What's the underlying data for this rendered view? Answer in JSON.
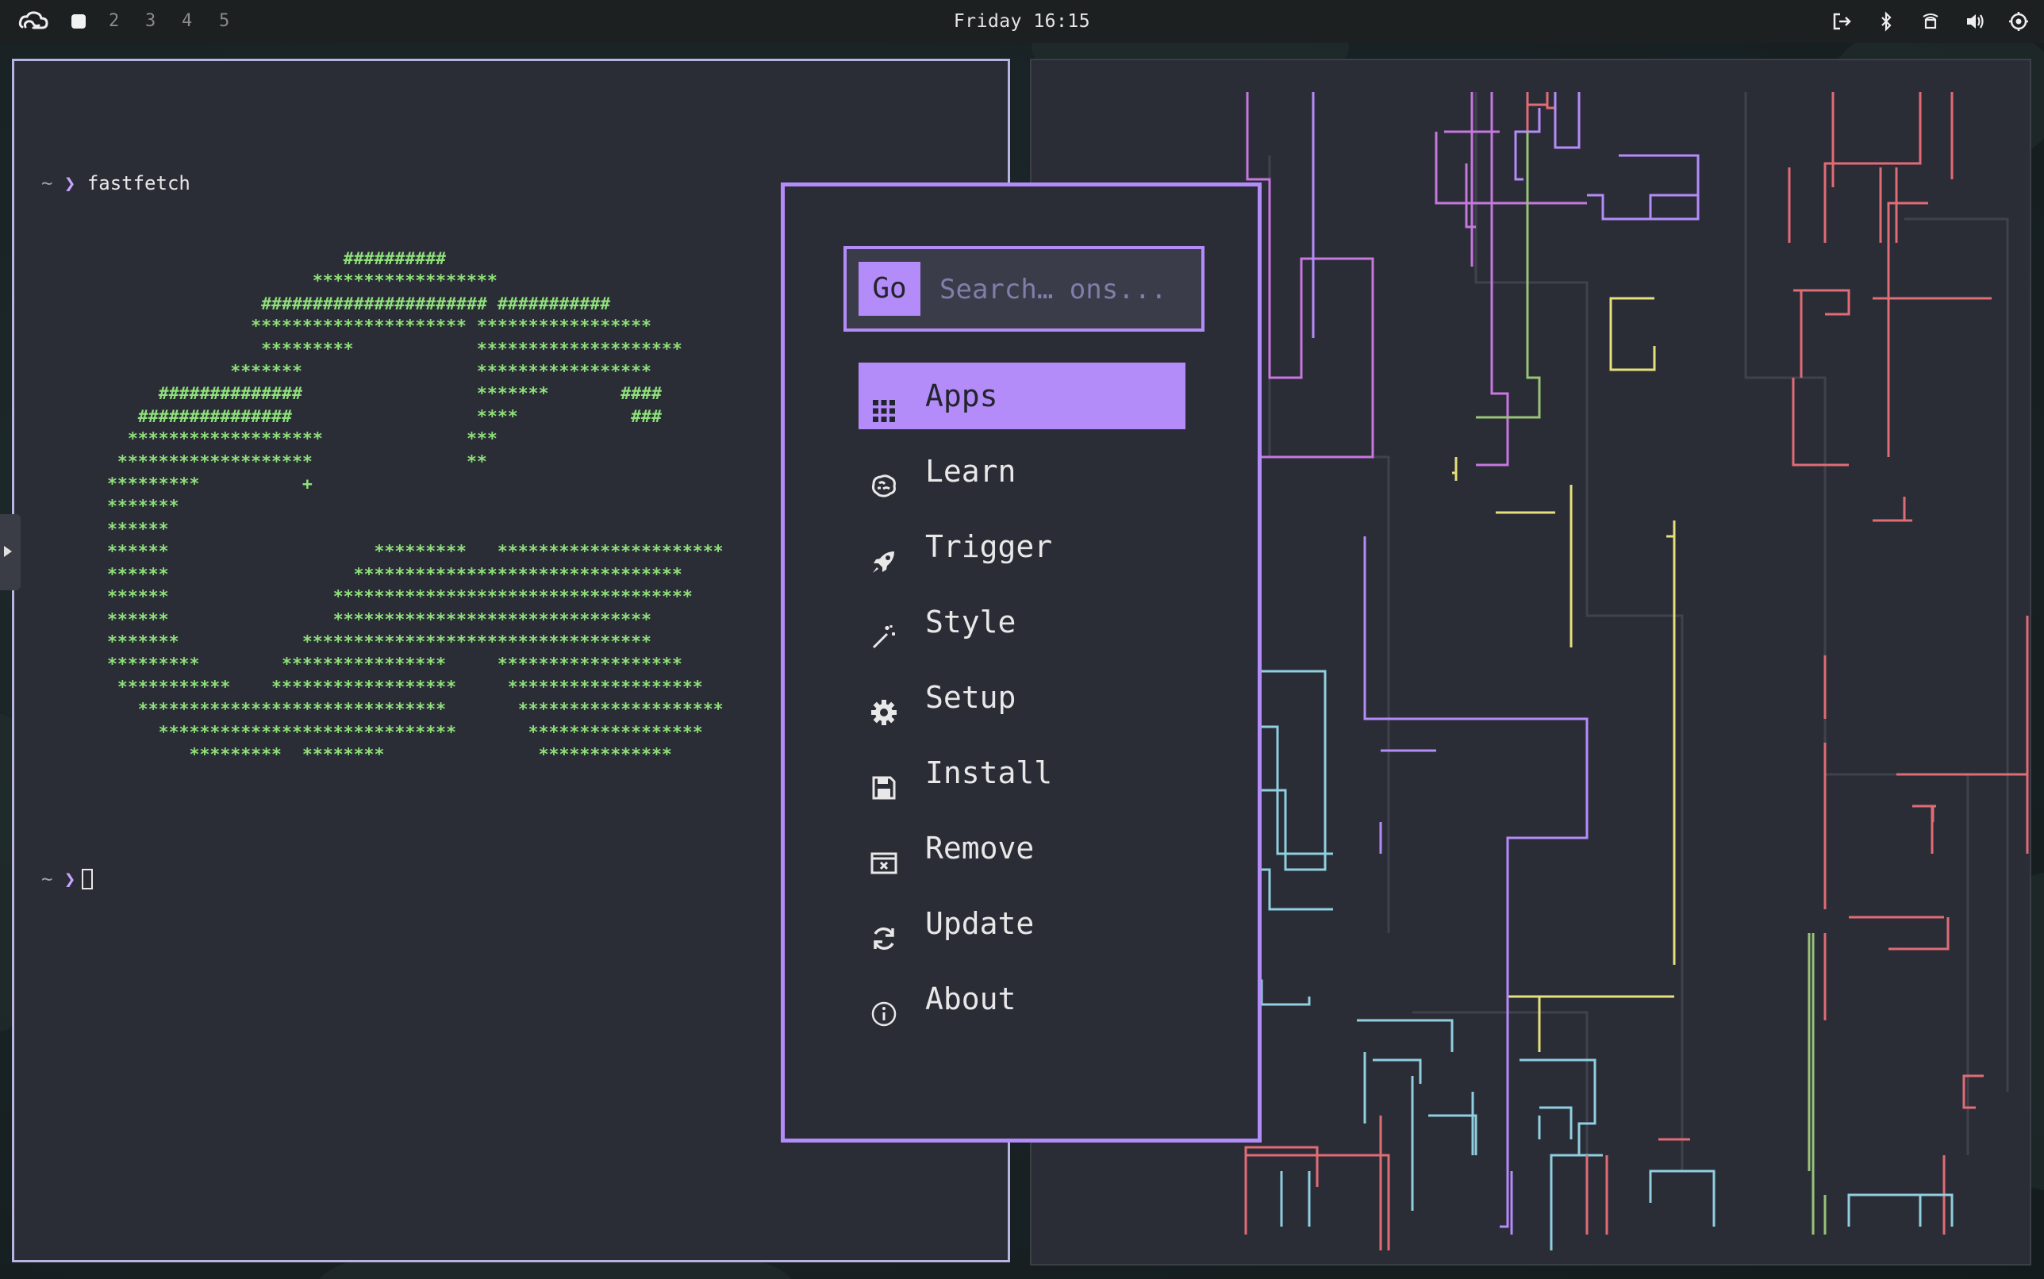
{
  "topbar": {
    "logo_icon": "cloud-logo-icon",
    "workspaces": [
      {
        "label": "",
        "active": true
      },
      {
        "label": "2",
        "active": false
      },
      {
        "label": "3",
        "active": false
      },
      {
        "label": "4",
        "active": false
      },
      {
        "label": "5",
        "active": false
      }
    ],
    "clock": "Friday 16:15",
    "tray_icons": [
      "logout-icon",
      "bluetooth-icon",
      "network-icon",
      "volume-icon",
      "power-icon"
    ]
  },
  "terminal": {
    "prompt_symbol": "~",
    "prompt_arrow": "❯",
    "command": "fastfetch",
    "ascii_logo": "                        ##########\n                     ******************\n                ###################### ###########\n               ********************* *****************\n                *********            ********************\n             *******                 *****************\n      ##############                 *******       ####\n    ###############                  ****           ###\n   *******************              ***\n  *******************               **\n *********          +\n *******\n ******\n ******                    *********   **********************\n ******                  ********************************\n ******                ***********************************\n ******                *******************************\n *******            **********************************\n *********        ****************     ******************\n  ***********    ******************     *******************\n    ******************************       ********************\n      *****************************       *****************\n         *********  ********               *************",
    "colors": {
      "background": "#2b2d36",
      "logo": "#8ee07a",
      "prompt_arrow": "#c8a3ff"
    }
  },
  "launcher": {
    "search": {
      "button_label": "Go",
      "placeholder": "Search… ons..."
    },
    "items": [
      {
        "label": "Apps",
        "icon": "grid-icon",
        "selected": true
      },
      {
        "label": "Learn",
        "icon": "brain-icon",
        "selected": false
      },
      {
        "label": "Trigger",
        "icon": "rocket-icon",
        "selected": false
      },
      {
        "label": "Style",
        "icon": "magic-wand-icon",
        "selected": false
      },
      {
        "label": "Setup",
        "icon": "gear-icon",
        "selected": false
      },
      {
        "label": "Install",
        "icon": "floppy-disk-icon",
        "selected": false
      },
      {
        "label": "Remove",
        "icon": "remove-window-icon",
        "selected": false
      },
      {
        "label": "Update",
        "icon": "refresh-icon",
        "selected": false
      },
      {
        "label": "About",
        "icon": "info-icon",
        "selected": false
      }
    ],
    "accent": "#b48cfa"
  },
  "pipes": {
    "colors": [
      "#e06c75",
      "#c678dd",
      "#b48cfa",
      "#98c379",
      "#e5e07a",
      "#8fcfe0"
    ]
  }
}
